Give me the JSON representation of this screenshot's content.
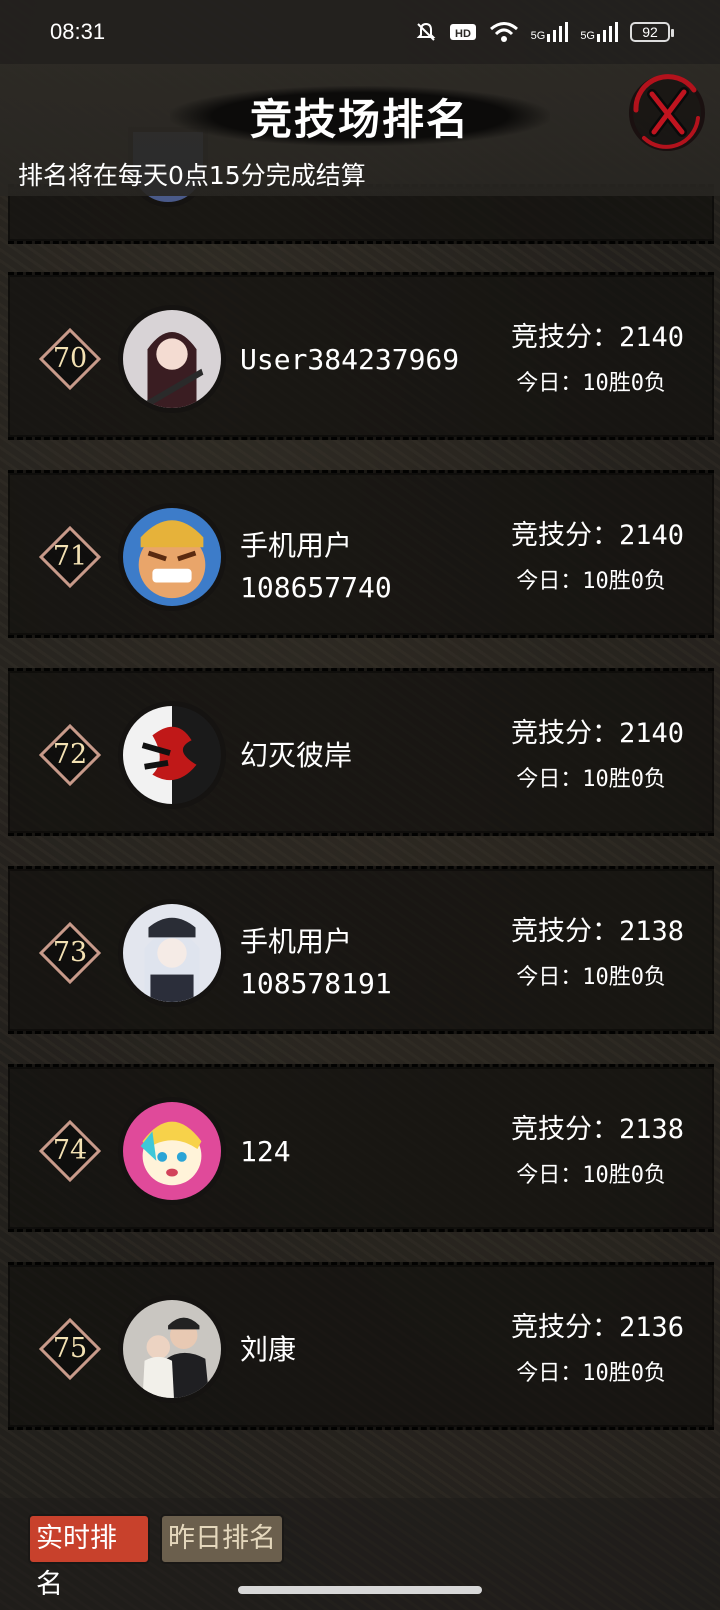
{
  "status_bar": {
    "time": "08:31",
    "icons": [
      "mute-icon",
      "hd-icon",
      "wifi-icon",
      "signal-5g-icon",
      "signal-5g-icon",
      "battery-icon"
    ],
    "signal_label_1": "5G",
    "signal_label_2": "5G",
    "battery": "92"
  },
  "header": {
    "title": "竞技场排名",
    "subtitle": "排名将在每天0点15分完成结算",
    "close_icon": "close-x-icon"
  },
  "rankings": [
    {
      "rank": "70",
      "name": "User384237969",
      "name_line2": "",
      "score": "竞技分：2140",
      "today": "今日：10胜0负"
    },
    {
      "rank": "71",
      "name": "手机用户",
      "name_line2": "108657740",
      "score": "竞技分：2140",
      "today": "今日：10胜0负"
    },
    {
      "rank": "72",
      "name": "幻灭彼岸",
      "name_line2": "",
      "score": "竞技分：2140",
      "today": "今日：10胜0负"
    },
    {
      "rank": "73",
      "name": "手机用户",
      "name_line2": "108578191",
      "score": "竞技分：2138",
      "today": "今日：10胜0负"
    },
    {
      "rank": "74",
      "name": "124",
      "name_line2": "",
      "score": "竞技分：2138",
      "today": "今日：10胜0负"
    },
    {
      "rank": "75",
      "name": "刘康",
      "name_line2": "",
      "score": "竞技分：2136",
      "today": "今日：10胜0负"
    }
  ],
  "tabs": {
    "realtime": "实时排名",
    "yesterday": "昨日排名",
    "active": "realtime"
  },
  "colors": {
    "active_tab": "#c8412c",
    "inactive_tab": "#6b5f4d",
    "rank_border": "#c89a8a",
    "rank_text": "#f3e1b3",
    "close_red": "#b3121c"
  }
}
